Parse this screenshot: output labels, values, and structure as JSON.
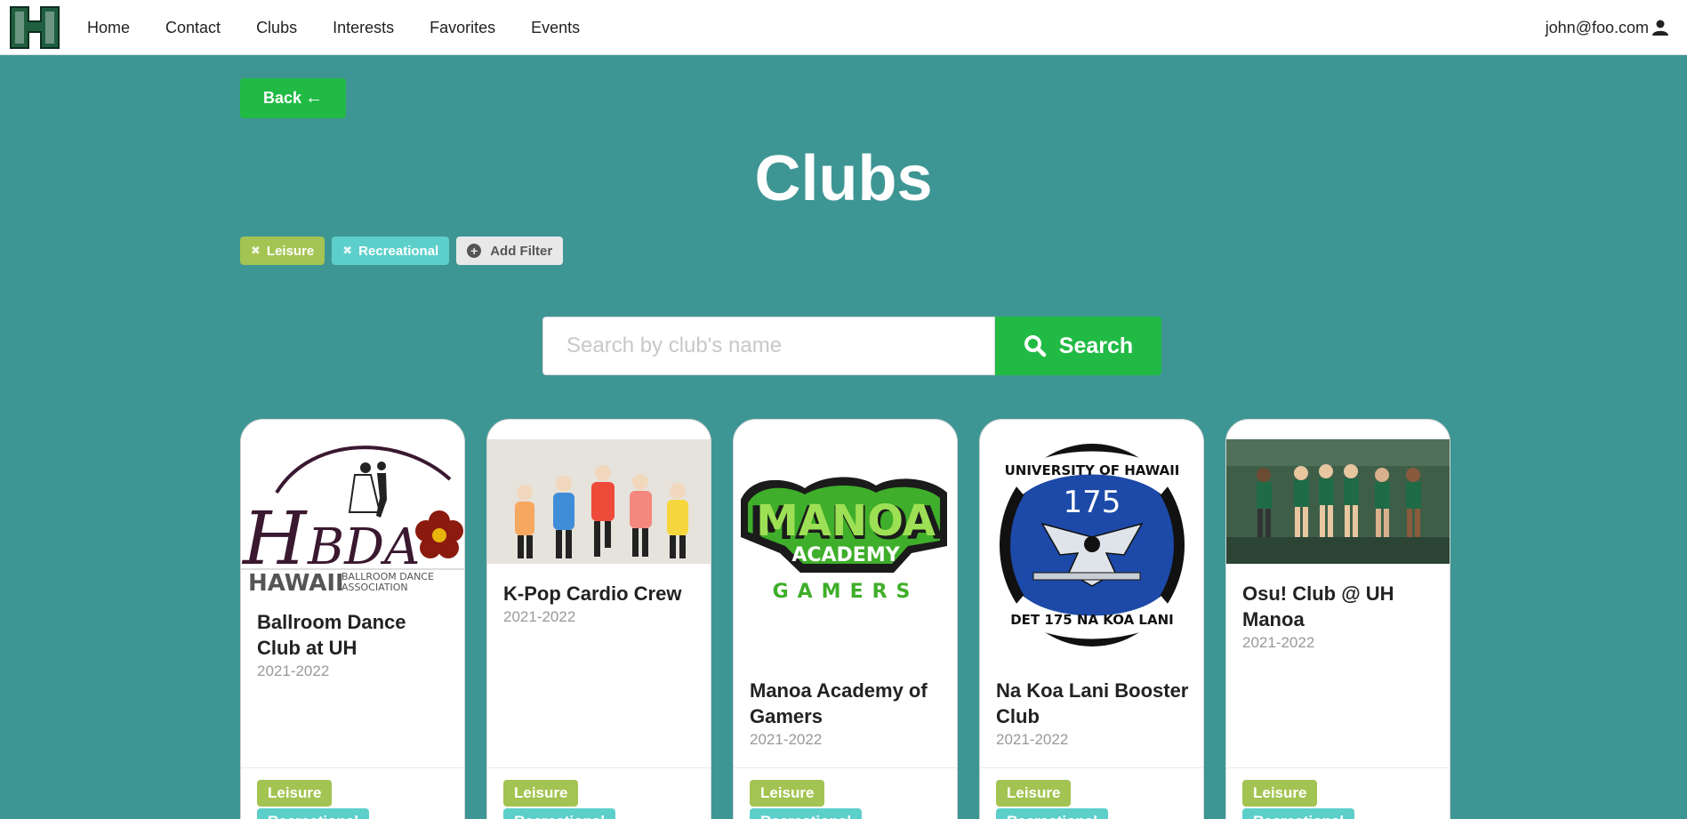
{
  "nav": {
    "links": [
      "Home",
      "Contact",
      "Clubs",
      "Interests",
      "Favorites",
      "Events"
    ],
    "user_email": "john@foo.com"
  },
  "back_label": "Back",
  "title": "Clubs",
  "filters": {
    "active": [
      "Leisure",
      "Recreational"
    ],
    "add_label": "Add Filter"
  },
  "search": {
    "placeholder": "Search by club's name",
    "button_label": "Search"
  },
  "clubs": [
    {
      "name": "Ballroom Dance Club at UH",
      "year": "2021-2022",
      "tags": [
        "Leisure",
        "Recreational"
      ],
      "logo_text": [
        "HBDA",
        "HAWAII",
        "BALLROOM DANCE",
        "ASSOCIATION"
      ]
    },
    {
      "name": "K-Pop Cardio Crew",
      "year": "2021-2022",
      "tags": [
        "Leisure",
        "Recreational"
      ]
    },
    {
      "name": "Manoa Academy of Gamers",
      "year": "2021-2022",
      "tags": [
        "Leisure",
        "Recreational"
      ],
      "logo_text": [
        "MANOA",
        "ACADEMY",
        "GAMERS"
      ]
    },
    {
      "name": "Na Koa Lani Booster Club",
      "year": "2021-2022",
      "tags": [
        "Leisure",
        "Recreational"
      ],
      "logo_text": [
        "UNIVERSITY OF HAWAII",
        "175",
        "DET 175 NA KOA LANI"
      ]
    },
    {
      "name": "Osu! Club @ UH Manoa",
      "year": "2021-2022",
      "tags": [
        "Leisure",
        "Recreational"
      ]
    }
  ],
  "colors": {
    "background": "#3e9694",
    "green": "#21ba45",
    "leisure": "#a3c452",
    "recreational": "#5dcfcb"
  }
}
